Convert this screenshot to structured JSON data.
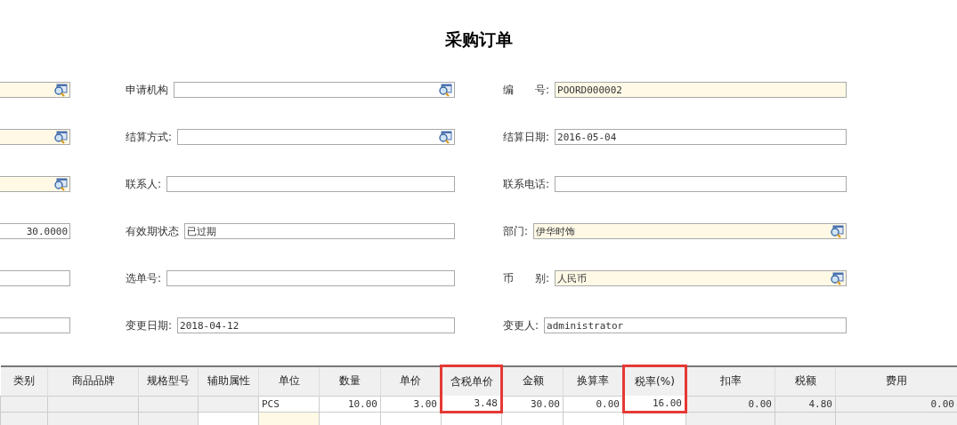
{
  "title": "采购订单",
  "form": {
    "left": [
      {
        "required": true,
        "lookup": true
      },
      {
        "required": true,
        "lookup": true
      },
      {
        "required": true,
        "lookup": true
      },
      {
        "value": "30.0000",
        "kind": "numeric",
        "required": false,
        "lookup": false
      },
      {
        "required": false,
        "lookup": false
      },
      {
        "required": false,
        "lookup": false
      }
    ],
    "middle": [
      {
        "label": "申请机构",
        "required": false,
        "lookup": true
      },
      {
        "label": "结算方式:",
        "required": false,
        "lookup": true
      },
      {
        "label": "联系人:",
        "required": false,
        "lookup": false
      },
      {
        "label": "有效期状态",
        "value": "已过期",
        "required": false,
        "lookup": false
      },
      {
        "label": "选单号:",
        "required": false,
        "lookup": false
      },
      {
        "label": "变更日期:",
        "value": "2018-04-12",
        "required": false,
        "lookup": false
      }
    ],
    "right": [
      {
        "label": "编　　号:",
        "value": "POORD000002",
        "required": true,
        "lookup": false
      },
      {
        "label": "结算日期:",
        "value": "2016-05-04",
        "required": false,
        "lookup": false
      },
      {
        "label": "联系电话:",
        "required": false,
        "lookup": false
      },
      {
        "label": "部门:",
        "value": "伊华时饰",
        "required": true,
        "lookup": true
      },
      {
        "label": "币　　别:",
        "value": "人民币",
        "required": true,
        "lookup": true
      },
      {
        "label": "变更人:",
        "value": "administrator",
        "required": false,
        "lookup": false
      }
    ]
  },
  "table": {
    "columns": [
      {
        "label": "类别",
        "highlighted": false
      },
      {
        "label": "商品品牌",
        "highlighted": false
      },
      {
        "label": "规格型号",
        "highlighted": false
      },
      {
        "label": "辅助属性",
        "highlighted": false
      },
      {
        "label": "单位",
        "highlighted": false
      },
      {
        "label": "数量",
        "highlighted": false
      },
      {
        "label": "单价",
        "highlighted": false
      },
      {
        "label": "含税单价",
        "highlighted": true
      },
      {
        "label": "金额",
        "highlighted": false
      },
      {
        "label": "换算率",
        "highlighted": false
      },
      {
        "label": "税率(%)",
        "highlighted": true
      },
      {
        "label": "扣率",
        "highlighted": false
      },
      {
        "label": "税额",
        "highlighted": false
      },
      {
        "label": "费用",
        "highlighted": false
      }
    ],
    "rows": [
      {
        "cells": [
          {
            "kind": "readonly"
          },
          {
            "kind": "readonly"
          },
          {
            "kind": "readonly"
          },
          {
            "kind": "readonly"
          },
          {
            "kind": "edit",
            "text": "PCS"
          },
          {
            "kind": "edit",
            "text": "10.00"
          },
          {
            "kind": "edit",
            "text": "3.00"
          },
          {
            "kind": "edit",
            "text": "3.48"
          },
          {
            "kind": "edit",
            "text": "30.00"
          },
          {
            "kind": "edit",
            "text": "0.00"
          },
          {
            "kind": "edit",
            "text": "16.00"
          },
          {
            "kind": "readonly",
            "text": "0.00"
          },
          {
            "kind": "readonly",
            "text": "4.80"
          },
          {
            "kind": "readonly",
            "text": "0.00"
          }
        ]
      },
      {
        "cells": [
          {
            "kind": "readonly"
          },
          {
            "kind": "readonly"
          },
          {
            "kind": "readonly"
          },
          {
            "kind": "edit"
          },
          {
            "kind": "required"
          },
          {
            "kind": "edit"
          },
          {
            "kind": "edit"
          },
          {
            "kind": "edit"
          },
          {
            "kind": "edit"
          },
          {
            "kind": "edit"
          },
          {
            "kind": "edit"
          },
          {
            "kind": "readonly"
          },
          {
            "kind": "readonly"
          },
          {
            "kind": "readonly"
          }
        ]
      }
    ]
  }
}
